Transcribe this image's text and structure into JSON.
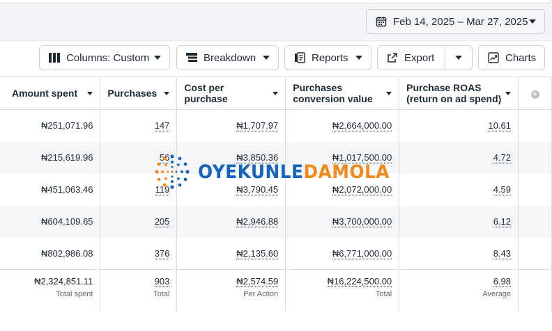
{
  "toolbar": {
    "date_range": "Feb 14, 2025 – Mar 27, 2025",
    "columns_label": "Columns: Custom",
    "breakdown_label": "Breakdown",
    "reports_label": "Reports",
    "export_label": "Export",
    "charts_label": "Charts"
  },
  "table": {
    "headers": {
      "amount_spent": "Amount spent",
      "purchases": "Purchases",
      "cost_per_purchase_1": "Cost per",
      "cost_per_purchase_2": "purchase",
      "conv_value_1": "Purchases",
      "conv_value_2": "conversion value",
      "roas_1": "Purchase ROAS",
      "roas_2": "(return on ad spend)"
    },
    "rows": [
      {
        "amount": "₦251,071.96",
        "purchases": "147",
        "cost": "₦1,707.97",
        "value": "₦2,664,000.00",
        "roas": "10.61"
      },
      {
        "amount": "₦215,619.96",
        "purchases": "56",
        "cost": "₦3,850.36",
        "value": "₦1,017,500.00",
        "roas": "4.72"
      },
      {
        "amount": "₦451,063.46",
        "purchases": "119",
        "cost": "₦3,790.45",
        "value": "₦2,072,000.00",
        "roas": "4.59"
      },
      {
        "amount": "₦604,109.65",
        "purchases": "205",
        "cost": "₦2,946.88",
        "value": "₦3,700,000.00",
        "roas": "6.12"
      },
      {
        "amount": "₦802,986.08",
        "purchases": "376",
        "cost": "₦2,135.60",
        "value": "₦6,771,000.00",
        "roas": "8.43"
      }
    ],
    "totals": {
      "amount": "₦2,324,851.11",
      "amount_sub": "Total spent",
      "purchases": "903",
      "purchases_sub": "Total",
      "cost": "₦2,574.59",
      "cost_sub": "Per Action",
      "value": "₦16,224,500.00",
      "value_sub": "Total",
      "roas": "6.98",
      "roas_sub": "Average"
    }
  },
  "watermark": {
    "part1": "OYEKUNLE",
    "part2": "DAMOLA"
  },
  "colors": {
    "watermark_blue": "#1565c0",
    "watermark_orange": "#f18a1c"
  }
}
